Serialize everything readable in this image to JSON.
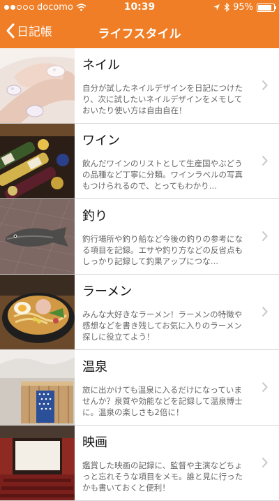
{
  "status_bar": {
    "carrier": "docomo",
    "time": "10:39",
    "battery_percent": "95%",
    "battery_level": 0.95,
    "signal_filled": 2,
    "signal_total": 5,
    "icons": [
      "signal-icon",
      "wifi-icon",
      "location-icon",
      "bluetooth-icon",
      "battery-icon"
    ]
  },
  "nav": {
    "back_label": "日記帳",
    "title": "ライフスタイル"
  },
  "colors": {
    "header": "#ef7e26",
    "title_text": "#111111",
    "desc_text": "#666666"
  },
  "items": [
    {
      "title": "ネイル",
      "desc": "自分が試したネイルデザインを日記につけたり、次に試したいネイルデザインをメモしておいたり使い方は自由自在！",
      "thumb": "nail-photo"
    },
    {
      "title": "ワイン",
      "desc": "飲んだワインのリストとして生産国やぶどうの品種など丁寧に分類。ワインラベルの写真もつけられるので、とってもわかり…",
      "thumb": "wine-photo"
    },
    {
      "title": "釣り",
      "desc": "釣行場所や釣り船など今後の釣りの参考になる項目を記録。エサや釣り方などの反省点もしっかり記録して釣果アップにつな…",
      "thumb": "fish-photo"
    },
    {
      "title": "ラーメン",
      "desc": "みんな大好きなラーメン！ラーメンの特徴や感想などを書き残してお気に入りのラーメン探しに役立てよう！",
      "thumb": "ramen-photo"
    },
    {
      "title": "温泉",
      "desc": "旅に出かけても温泉に入るだけになっていませんか？泉質や効能などを記録して温泉博士に。温泉の楽しさも2倍に！",
      "thumb": "onsen-photo"
    },
    {
      "title": "映画",
      "desc": "鑑賞した映画の記録に、監督や主演などちょっと忘れそうな項目をメモ。誰と見に行ったかも書いておくと便利！",
      "thumb": "cinema-photo"
    }
  ]
}
